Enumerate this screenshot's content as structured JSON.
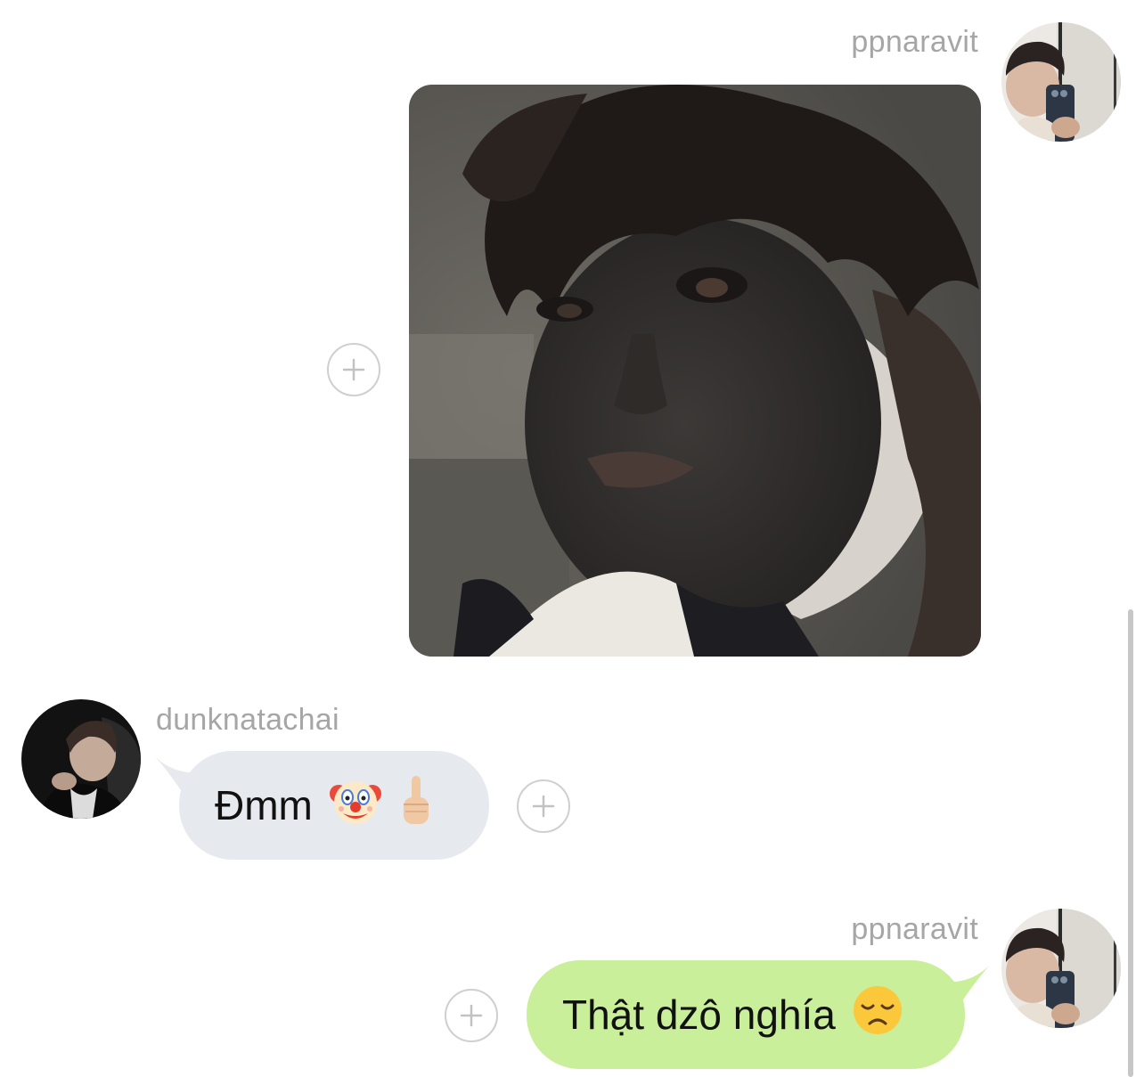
{
  "messages": [
    {
      "sender": "ppnaravit",
      "type": "image",
      "image_description_icon": "photo-attachment"
    },
    {
      "sender": "dunknatachai",
      "type": "text",
      "text": "Đmm",
      "emojis": [
        "clown-face-emoji",
        "middle-finger-emoji"
      ]
    },
    {
      "sender": "ppnaravit",
      "type": "text",
      "text": "Thật dzô nghía",
      "emojis": [
        "disappointed-face-emoji"
      ]
    }
  ],
  "colors": {
    "incoming_bubble": "#e6e9ee",
    "outgoing_bubble": "#c9ef9a",
    "username": "#a6a6a6"
  }
}
